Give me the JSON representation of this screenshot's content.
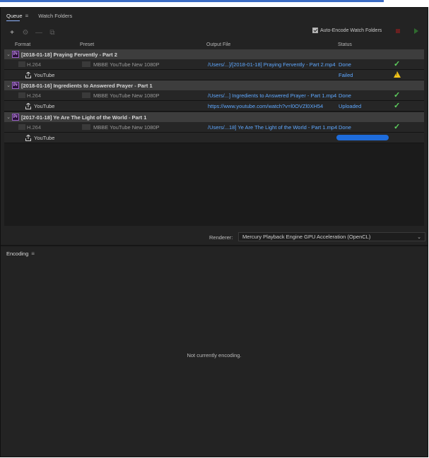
{
  "tabs": {
    "queue": "Queue",
    "watch_folders": "Watch Folders"
  },
  "toolbar": {
    "add": "+",
    "settings": "⚙",
    "remove": "—",
    "duplicate": "⧉"
  },
  "auto_encode": {
    "label": "Auto-Encode Watch Folders",
    "checked": true
  },
  "columns": {
    "format": "Format",
    "preset": "Preset",
    "output": "Output File",
    "status": "Status"
  },
  "queue": [
    {
      "title": "[2018-01-18] Praying Fervently - Part 2",
      "encode": {
        "format": "H.264",
        "preset": "MBBE YouTube New 1080P",
        "output": "/Users/...]/[2018-01-18] Praying Fervently - Part 2.mp4",
        "status": "Done"
      },
      "publish": {
        "destination": "YouTube",
        "output": "",
        "status": "Failed"
      }
    },
    {
      "title": "[2018-01-16] Ingredients to Answered Prayer - Part 1",
      "encode": {
        "format": "H.264",
        "preset": "MBBE YouTube New 1080P",
        "output": "/Users/...] Ingredients to Answered Prayer - Part 1.mp4",
        "status": "Done"
      },
      "publish": {
        "destination": "YouTube",
        "output": "https://www.youtube.com/watch?v=l0OVZl0XH54",
        "status": "Uploaded"
      }
    },
    {
      "title": "[2017-01-18] Ye Are The Light of the World - Part 1",
      "encode": {
        "format": "H.264",
        "preset": "MBBE YouTube New 1080P",
        "output": "/Users/...18] Ye Are The Light of the World - Part 1.mp4",
        "status": "Done"
      },
      "publish": {
        "destination": "YouTube",
        "output": "",
        "status": "",
        "progress": 1.0
      }
    }
  ],
  "renderer": {
    "label": "Renderer:",
    "value": "Mercury Playback Engine GPU Acceleration (OpenCL)"
  },
  "encoding": {
    "tab": "Encoding",
    "empty_message": "Not currently encoding."
  },
  "colors": {
    "link": "#5fa8ff",
    "success": "#5ed05e",
    "warning": "#f2c318",
    "progress": "#1e6cdb",
    "premiere_badge": "#9a62c8"
  }
}
